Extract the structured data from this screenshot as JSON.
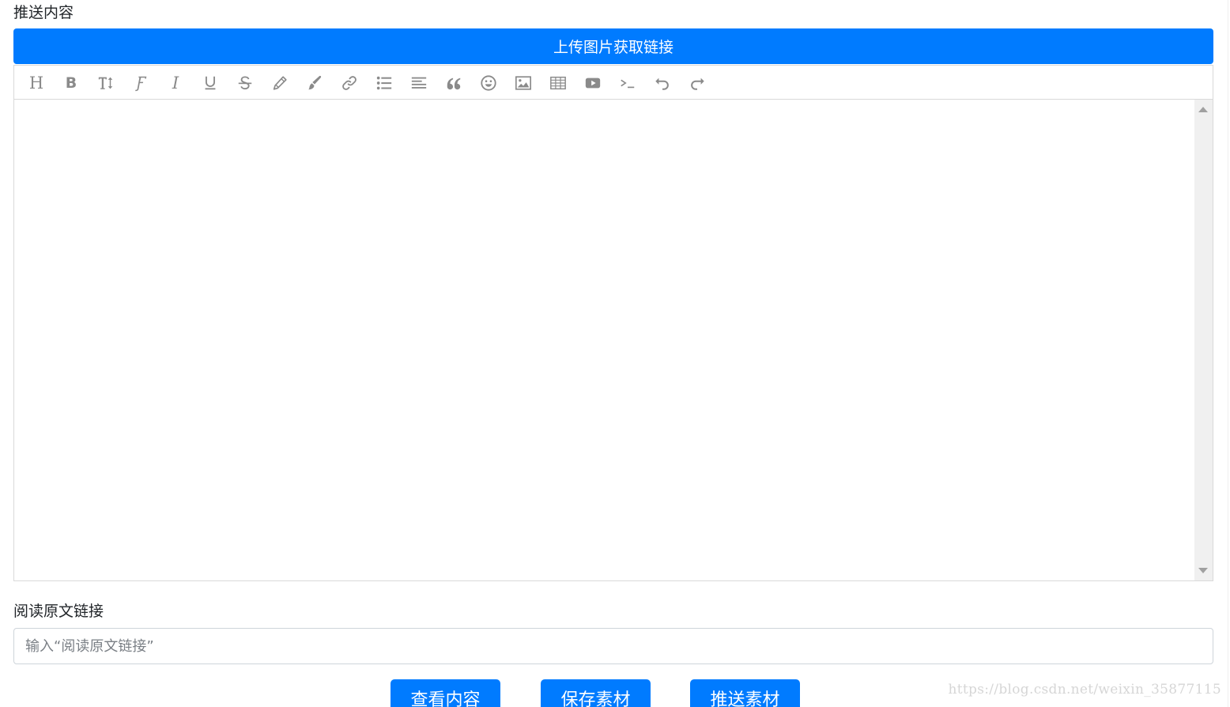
{
  "labels": {
    "content": "推送内容",
    "read_original_link": "阅读原文链接"
  },
  "upload_button": "上传图片获取链接",
  "toolbar": {
    "buttons": [
      {
        "name": "heading",
        "icon": "heading-icon",
        "text": "H"
      },
      {
        "name": "bold",
        "icon": "bold-icon",
        "text": "B"
      },
      {
        "name": "font-size",
        "icon": "font-size-icon"
      },
      {
        "name": "font-family",
        "icon": "font-family-icon"
      },
      {
        "name": "italic",
        "icon": "italic-icon",
        "text": "I"
      },
      {
        "name": "underline",
        "icon": "underline-icon"
      },
      {
        "name": "strikethrough",
        "icon": "strikethrough-icon"
      },
      {
        "name": "text-color",
        "icon": "pencil-icon"
      },
      {
        "name": "background-color",
        "icon": "paint-brush-icon"
      },
      {
        "name": "link",
        "icon": "link-icon"
      },
      {
        "name": "list",
        "icon": "list-icon"
      },
      {
        "name": "justify",
        "icon": "align-icon"
      },
      {
        "name": "quote",
        "icon": "quote-icon"
      },
      {
        "name": "emoticon",
        "icon": "smiley-icon"
      },
      {
        "name": "image",
        "icon": "image-icon"
      },
      {
        "name": "table",
        "icon": "table-icon"
      },
      {
        "name": "video",
        "icon": "video-icon"
      },
      {
        "name": "code",
        "icon": "code-icon"
      },
      {
        "name": "undo",
        "icon": "undo-icon"
      },
      {
        "name": "redo",
        "icon": "redo-icon"
      }
    ],
    "icon_color": "#8a8a8a"
  },
  "link_input": {
    "placeholder": "输入“阅读原文链接”",
    "value": ""
  },
  "actions": {
    "view": "查看内容",
    "save": "保存素材",
    "push": "推送素材"
  },
  "watermark": "https://blog.csdn.net/weixin_35877115",
  "colors": {
    "primary": "#007bff",
    "border": "#d9d9d9"
  }
}
